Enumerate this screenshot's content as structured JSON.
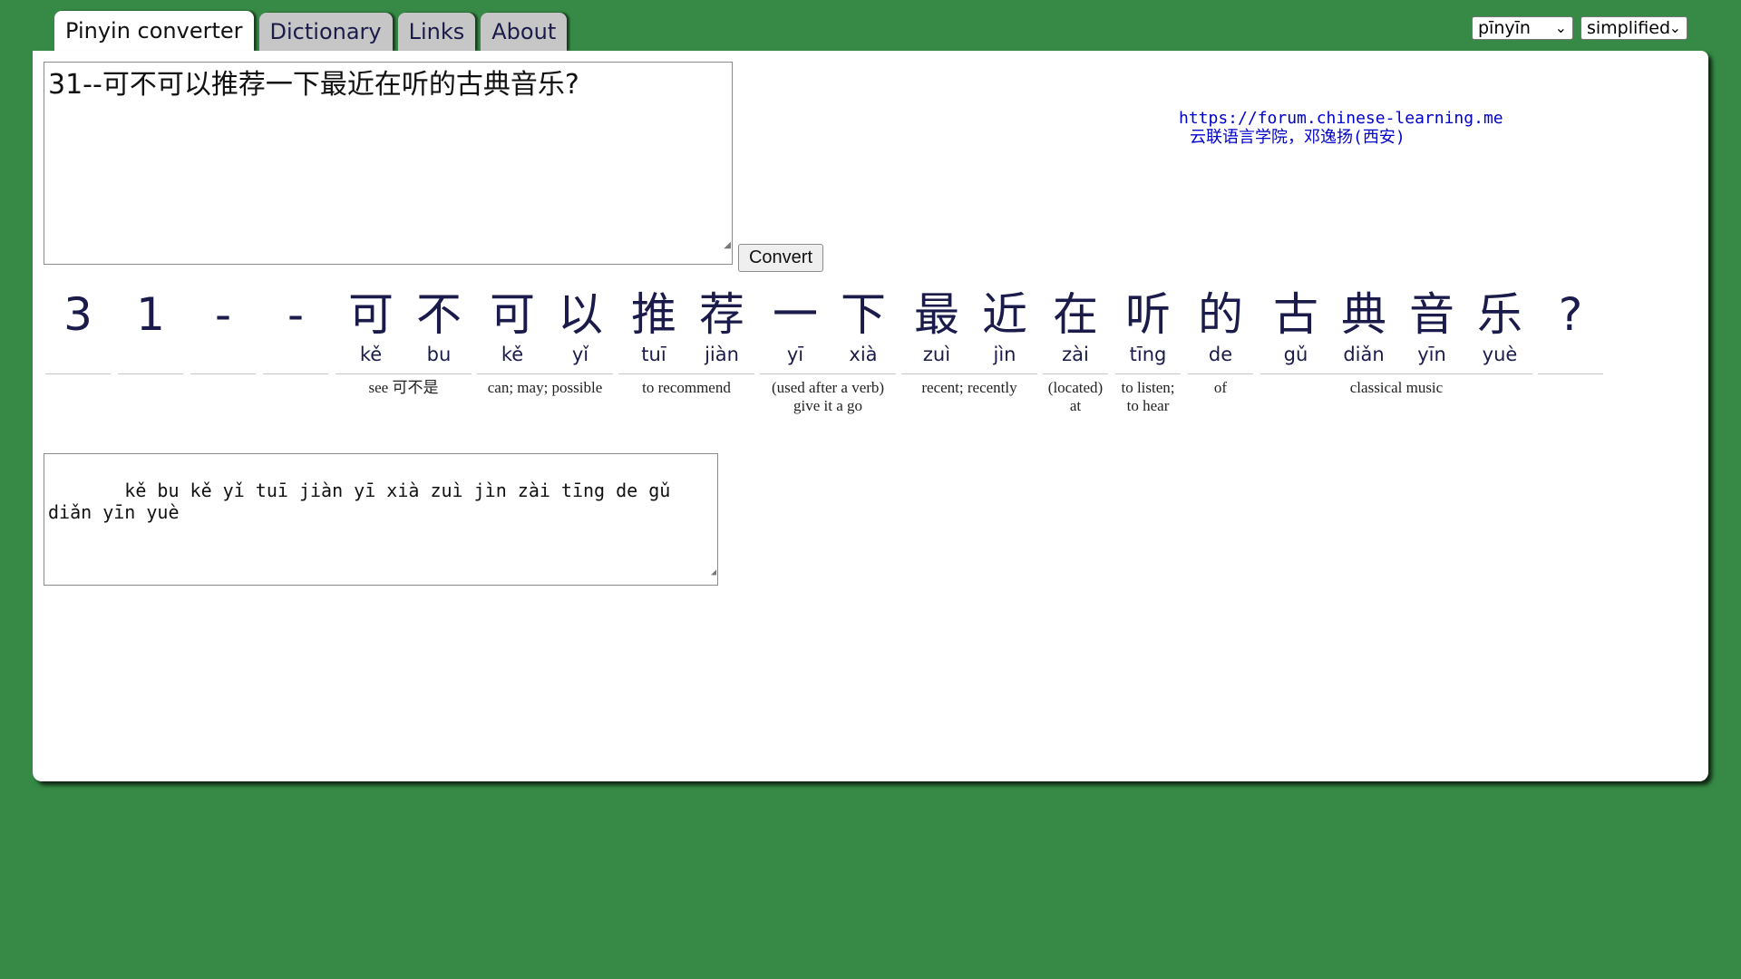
{
  "tabs": [
    {
      "label": "Pinyin converter",
      "active": true
    },
    {
      "label": "Dictionary"
    },
    {
      "label": "Links"
    },
    {
      "label": "About"
    }
  ],
  "selects": {
    "romanization": "pīnyīn",
    "script": "simplified"
  },
  "input": {
    "value": "31--可不可以推荐一下最近在听的古典音乐?"
  },
  "convert_label": "Convert",
  "credit": {
    "url": "https://forum.chinese-learning.me",
    "school": "云联语言学院，邓逸扬(西安)"
  },
  "characters": [
    {
      "hanzi": "3",
      "pinyin": ""
    },
    {
      "hanzi": "1",
      "pinyin": ""
    },
    {
      "hanzi": "-",
      "pinyin": ""
    },
    {
      "hanzi": "-",
      "pinyin": ""
    },
    {
      "hanzi": "可",
      "pinyin": "kě"
    },
    {
      "hanzi": "不",
      "pinyin": "bu"
    },
    {
      "hanzi": "可",
      "pinyin": "kě"
    },
    {
      "hanzi": "以",
      "pinyin": "yǐ"
    },
    {
      "hanzi": "推",
      "pinyin": "tuī"
    },
    {
      "hanzi": "荐",
      "pinyin": "jiàn"
    },
    {
      "hanzi": "一",
      "pinyin": "yī"
    },
    {
      "hanzi": "下",
      "pinyin": "xià"
    },
    {
      "hanzi": "最",
      "pinyin": "zuì"
    },
    {
      "hanzi": "近",
      "pinyin": "jìn"
    },
    {
      "hanzi": "在",
      "pinyin": "zài"
    },
    {
      "hanzi": "听",
      "pinyin": "tīng"
    },
    {
      "hanzi": "的",
      "pinyin": "de"
    },
    {
      "hanzi": "古",
      "pinyin": "gǔ"
    },
    {
      "hanzi": "典",
      "pinyin": "diǎn"
    },
    {
      "hanzi": "音",
      "pinyin": "yīn"
    },
    {
      "hanzi": "乐",
      "pinyin": "yuè"
    },
    {
      "hanzi": "?",
      "pinyin": ""
    }
  ],
  "glosses": [
    {
      "text": "see 可不是"
    },
    {
      "text": "can; may; possible"
    },
    {
      "text": "to recommend"
    },
    {
      "text": "(used after a verb)\ngive it a go"
    },
    {
      "text": "recent; recently"
    },
    {
      "text": "(located)\nat"
    },
    {
      "text": "to listen;\nto hear"
    },
    {
      "text": "of"
    },
    {
      "text": "classical music"
    }
  ],
  "output": {
    "value": "   kě bu kě yǐ tuī jiàn yī xià zuì jìn zài tīng de gǔ diǎn yīn yuè"
  }
}
